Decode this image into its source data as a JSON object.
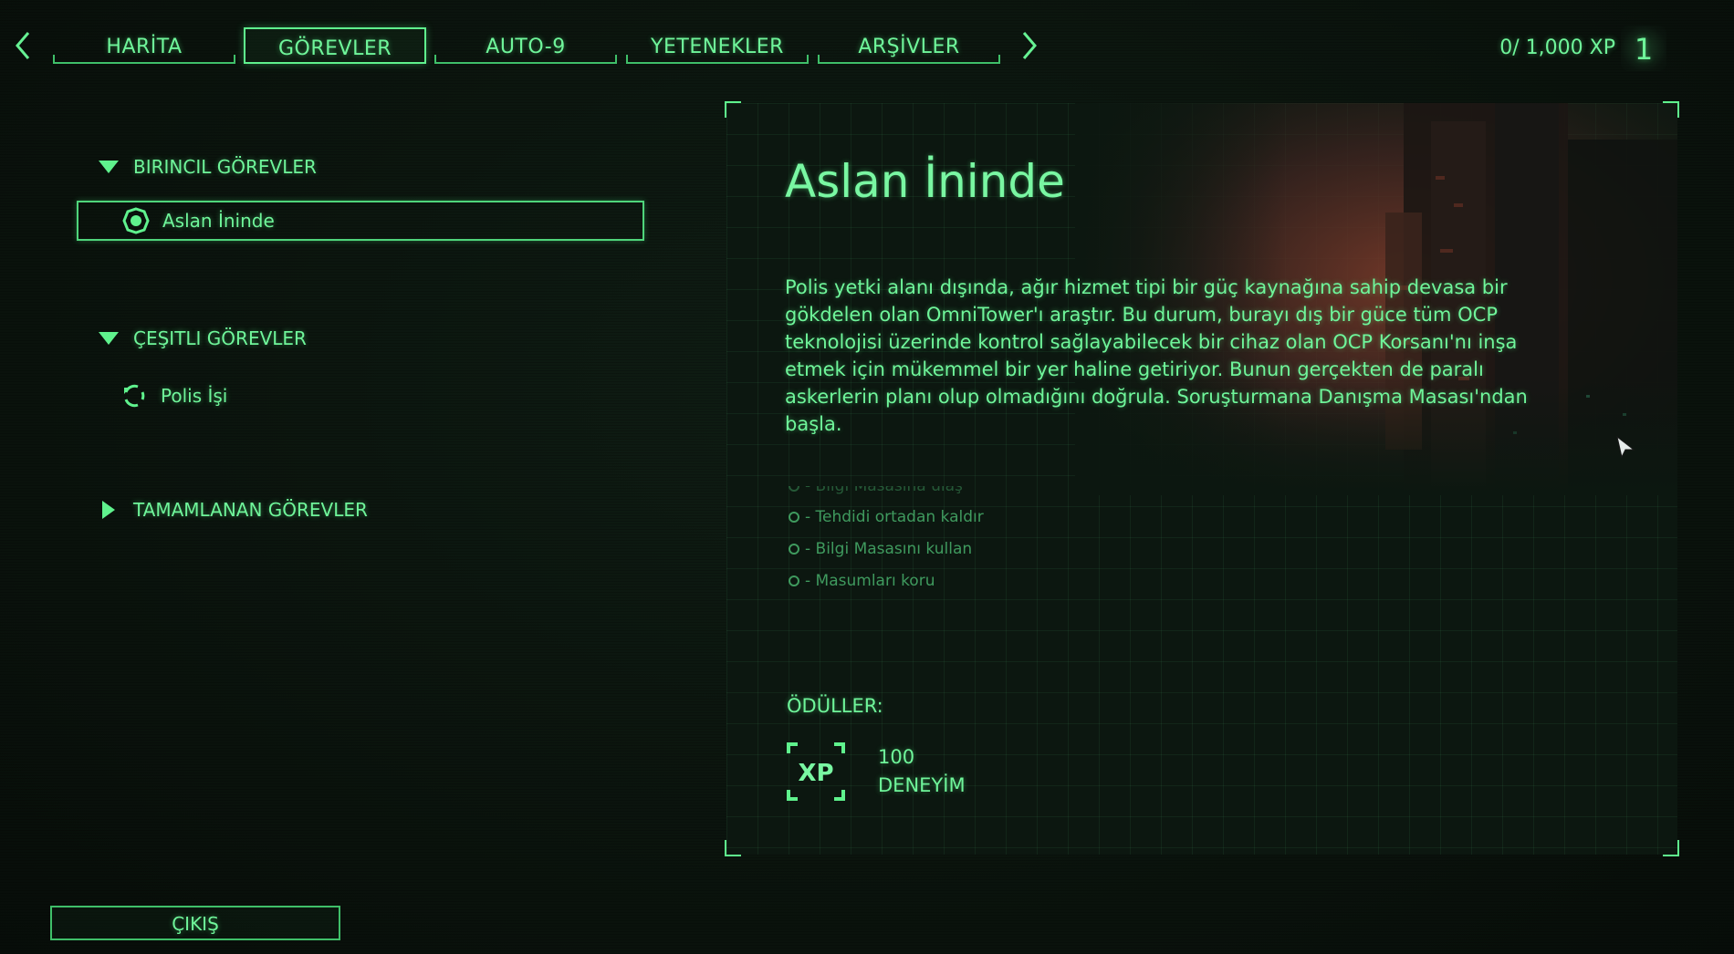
{
  "nav": {
    "tabs": [
      {
        "label": "HARİTA",
        "active": false
      },
      {
        "label": "GÖREVLER",
        "active": true
      },
      {
        "label": "AUTO-9",
        "active": false
      },
      {
        "label": "YETENEKLER",
        "active": false
      },
      {
        "label": "ARŞİVLER",
        "active": false
      }
    ],
    "prev_icon": "chevron-left-icon",
    "next_icon": "chevron-right-icon"
  },
  "player": {
    "xp": "0/ 1,000 XP",
    "level": "1"
  },
  "quest_list": {
    "primary": {
      "label": "BIRINCIL GÖREVLER",
      "expanded": true,
      "items": [
        {
          "label": "Aslan İninde",
          "selected": true,
          "icon": "target-icon"
        }
      ]
    },
    "misc": {
      "label": "ÇEŞITLI GÖREVLER",
      "expanded": true,
      "items": [
        {
          "label": "Polis İşi",
          "selected": false,
          "icon": "cycle-icon"
        }
      ]
    },
    "completed": {
      "label": "TAMAMLANAN GÖREVLER",
      "expanded": false
    }
  },
  "detail": {
    "title": "Aslan İninde",
    "description": "Polis yetki alanı dışında, ağır hizmet tipi bir güç kaynağına sahip devasa bir gökdelen olan OmniTower'ı araştır. Bu durum, burayı dış bir güce tüm OCP teknolojisi üzerinde kontrol sağlayabilecek bir cihaz olan OCP Korsanı'nı inşa etmek için mükemmel bir yer haline getiriyor. Bunun gerçekten de paralı askerlerin planı olup olmadığını doğrula. Soruşturmana Danışma Masası'ndan başla.",
    "objectives": [
      "- Bilgi Masasına ulaş",
      "- Tehdidi ortadan kaldır",
      "- Bilgi Masasını kullan",
      "- Masumları koru"
    ],
    "rewards_label": "ÖDÜLLER:",
    "reward": {
      "icon": "xp-icon",
      "icon_text": "XP",
      "amount": "100",
      "unit": "DENEYİM"
    }
  },
  "exit_label": "ÇIKIŞ",
  "colors": {
    "accent": "#6ff59a",
    "border": "#3fbf69",
    "background": "#0b140e",
    "muted": "#3f9a5e"
  }
}
